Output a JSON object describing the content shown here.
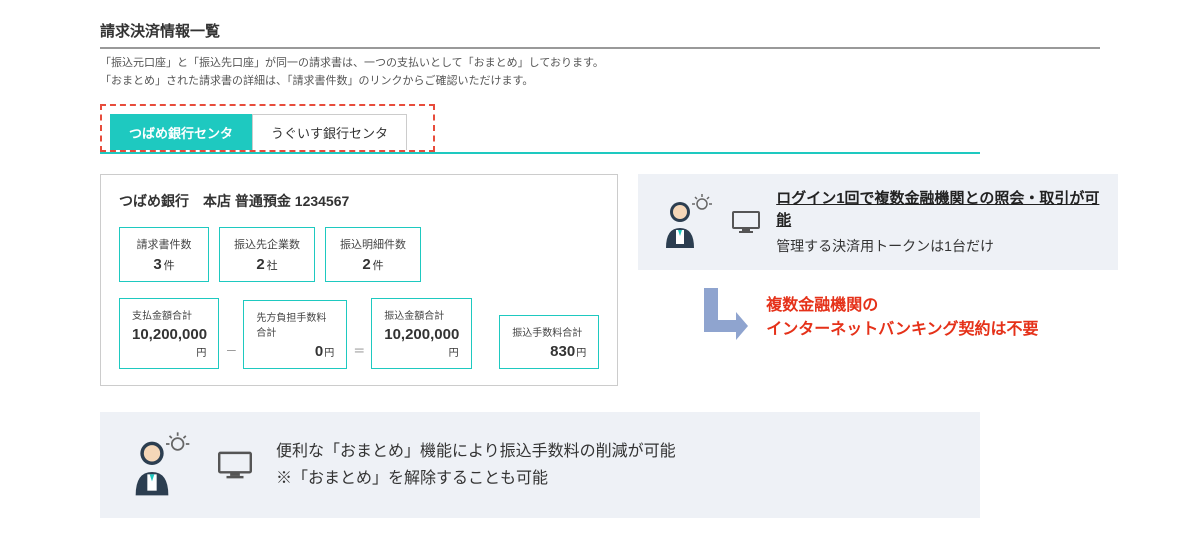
{
  "title": "請求決済情報一覧",
  "description_line1": "「振込元口座」と「振込先口座」が同一の請求書は、一つの支払いとして「おまとめ」しております。",
  "description_line2": "「おまとめ」された請求書の詳細は、「請求書件数」のリンクからご確認いただけます。",
  "tabs": {
    "active": "つばめ銀行センタ",
    "inactive": "うぐいす銀行センタ"
  },
  "account": {
    "name": "つばめ銀行　本店 普通預金 1234567"
  },
  "stats": {
    "requests": {
      "label": "請求書件数",
      "value": "3",
      "unit": "件"
    },
    "companies": {
      "label": "振込先企業数",
      "value": "2",
      "unit": "社"
    },
    "details": {
      "label": "振込明細件数",
      "value": "2",
      "unit": "件"
    }
  },
  "amounts": {
    "pay_total": {
      "label": "支払金額合計",
      "value": "10,200,000",
      "unit": "円"
    },
    "opp_fee": {
      "label": "先方負担手数料合計",
      "value": "0",
      "unit": "円"
    },
    "transfer_total": {
      "label": "振込金額合計",
      "value": "10,200,000",
      "unit": "円"
    },
    "fee_total": {
      "label": "振込手数料合計",
      "value": "830",
      "unit": "円"
    }
  },
  "callout_right": {
    "headline": "ログイン1回で複数金融機関との照会・取引が可能",
    "subline": "管理する決済用トークンは1台だけ"
  },
  "red_note_line1": "複数金融機関の",
  "red_note_line2": "インターネットバンキング契約は不要",
  "callout_bottom": {
    "line1": "便利な「おまとめ」機能により振込手数料の削減が可能",
    "line2": "※「おまとめ」を解除することも可能"
  }
}
